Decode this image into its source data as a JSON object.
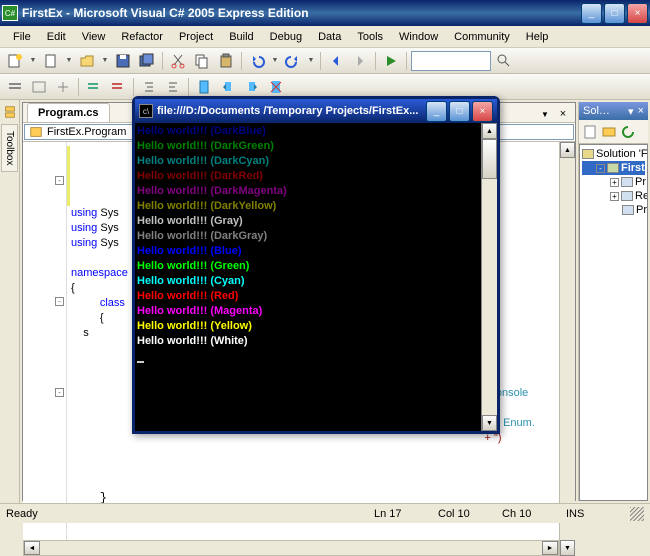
{
  "window": {
    "title": "FirstEx - Microsoft Visual C# 2005 Express Edition"
  },
  "menu": [
    "File",
    "Edit",
    "View",
    "Refactor",
    "Project",
    "Build",
    "Debug",
    "Data",
    "Tools",
    "Window",
    "Community",
    "Help"
  ],
  "editor": {
    "tab": "Program.cs",
    "nav_left": "FirstEx.Program",
    "code_visible": {
      "l1_kw": "using",
      "l1_rest": " Sys",
      "l2_kw": "using",
      "l2_rest": " Sys",
      "l3_kw": "using",
      "l3_rest": " Sys",
      "l4_kw": "namespace",
      "l5": "{",
      "l6_kw": "class",
      "l7": "{",
      "l8_pre": "    s",
      "frag1": "onsole",
      "frag2": "Enum.",
      "frag3": " + \")"
    }
  },
  "solution_explorer": {
    "title": "Sol…",
    "root": "Solution 'F",
    "project": "FirstE",
    "items": [
      "Pr",
      "Re",
      "Pr"
    ]
  },
  "sidetabs": [
    "Toolbox"
  ],
  "status": {
    "ready": "Ready",
    "ln": "Ln 17",
    "col": "Col 10",
    "ch": "Ch 10",
    "ins": "INS"
  },
  "console": {
    "title": "file:///D:/Documents /Temporary Projects/FirstEx...",
    "lines": [
      {
        "text": "Hello world!!! ",
        "name": "(DarkBlue)",
        "color": "#000080"
      },
      {
        "text": "Hello world!!! ",
        "name": "(DarkGreen)",
        "color": "#008000"
      },
      {
        "text": "Hello world!!! ",
        "name": "(DarkCyan)",
        "color": "#008080"
      },
      {
        "text": "Hello world!!! ",
        "name": "(DarkRed)",
        "color": "#800000"
      },
      {
        "text": "Hello world!!! ",
        "name": "(DarkMagenta)",
        "color": "#800080"
      },
      {
        "text": "Hello world!!! ",
        "name": "(DarkYellow)",
        "color": "#808000"
      },
      {
        "text": "Hello world!!! ",
        "name": "(Gray)",
        "color": "#c0c0c0"
      },
      {
        "text": "Hello world!!! ",
        "name": "(DarkGray)",
        "color": "#808080"
      },
      {
        "text": "Hello world!!! ",
        "name": "(Blue)",
        "color": "#0000ff"
      },
      {
        "text": "Hello world!!! ",
        "name": "(Green)",
        "color": "#00ff00"
      },
      {
        "text": "Hello world!!! ",
        "name": "(Cyan)",
        "color": "#00ffff"
      },
      {
        "text": "Hello world!!! ",
        "name": "(Red)",
        "color": "#ff0000"
      },
      {
        "text": "Hello world!!! ",
        "name": "(Magenta)",
        "color": "#ff00ff"
      },
      {
        "text": "Hello world!!! ",
        "name": "(Yellow)",
        "color": "#ffff00"
      },
      {
        "text": "Hello world!!! ",
        "name": "(White)",
        "color": "#ffffff"
      }
    ]
  }
}
